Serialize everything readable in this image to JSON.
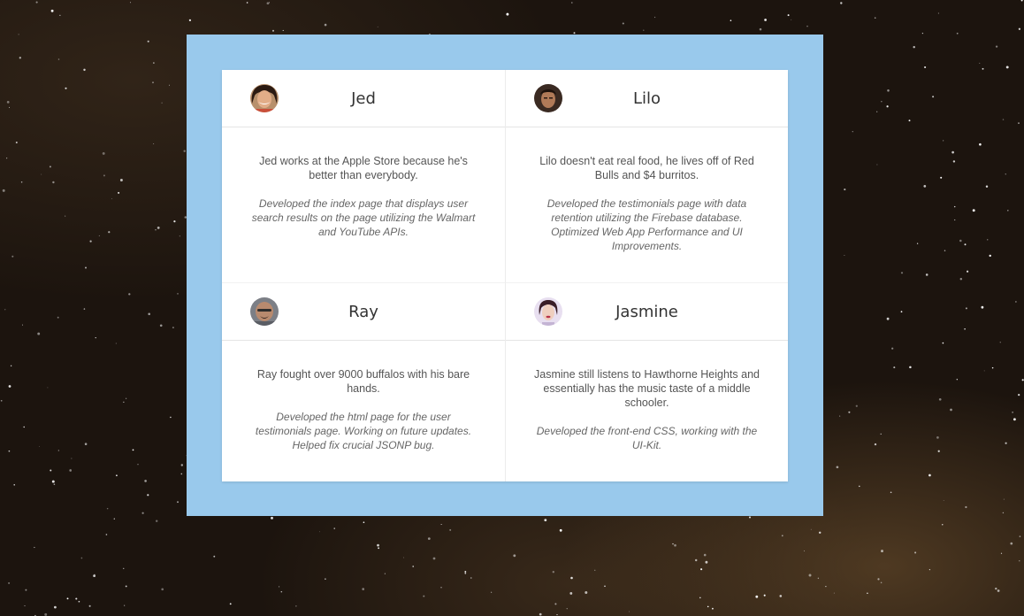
{
  "background": {
    "type": "starfield",
    "base_color": "#1c140e"
  },
  "frame": {
    "color": "#99c9ec"
  },
  "testimonials": [
    {
      "name": "Jed",
      "bio": "Jed works at the Apple Store because he's better than everybody.",
      "role": "Developed the index page that displays user search results on the page utilizing the Walmart and YouTube APIs."
    },
    {
      "name": "Lilo",
      "bio": "Lilo doesn't eat real food, he lives off of Red Bulls and $4 burritos.",
      "role": "Developed the testimonials page with data retention utilizing the Firebase database. Optimized Web App Performance and UI Improvements."
    },
    {
      "name": "Ray",
      "bio": "Ray fought over 9000 buffalos with his bare hands.",
      "role": "Developed the html page for the user testimonials page. Working on future updates. Helped fix crucial JSONP bug."
    },
    {
      "name": "Jasmine",
      "bio": "Jasmine still listens to Hawthorne Heights and essentially has the music taste of a middle schooler.",
      "role": "Developed the front-end CSS, working with the UI-Kit."
    }
  ]
}
